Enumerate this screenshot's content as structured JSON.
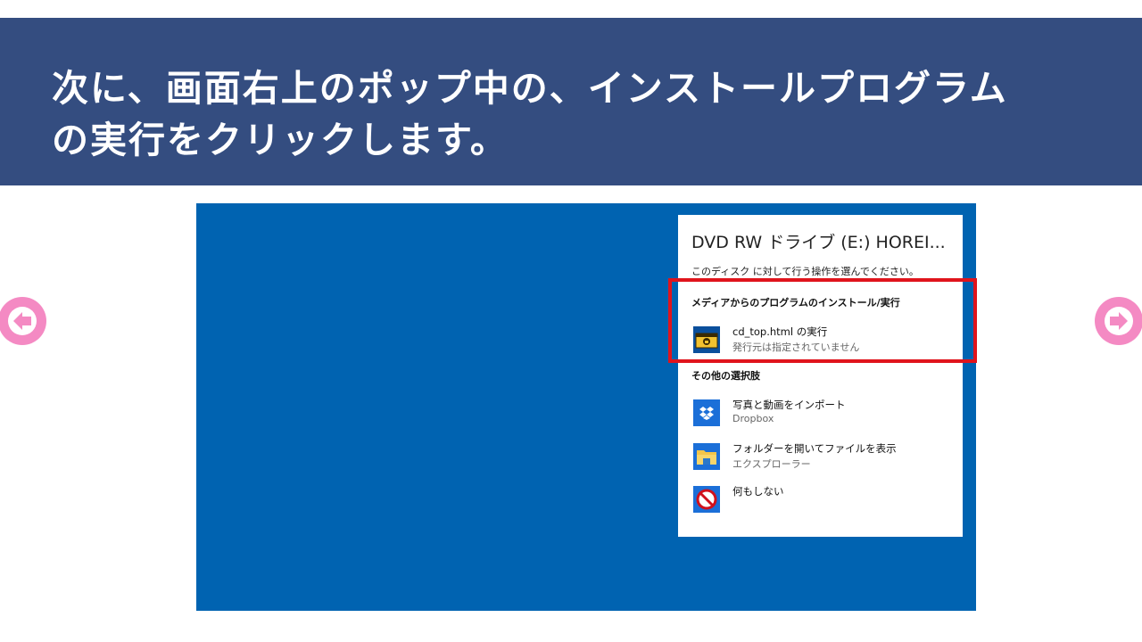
{
  "banner": {
    "text": "次に、画面右上のポップ中の、インストールプログラム\nの実行をクリックします。"
  },
  "colors": {
    "banner_bg": "#344d80",
    "screen_bg": "#0063b1",
    "highlight": "#e0141c",
    "nav_arrow": "#f48ac3"
  },
  "nav": {
    "prev_icon": "left-arrow-icon",
    "next_icon": "right-arrow-icon"
  },
  "popup": {
    "title": "DVD RW ドライブ (E:) HOREI...",
    "subtitle": "このディスク に対して行う操作を選んでください。",
    "section_install": "メディアからのプログラムのインストール/実行",
    "section_other": "その他の選択肢",
    "options": [
      {
        "main": "cd_top.html の実行",
        "sub": "発行元は指定されていません",
        "icon": "installer-icon"
      },
      {
        "main": "写真と動画をインポート",
        "sub": "Dropbox",
        "icon": "dropbox-icon"
      },
      {
        "main": "フォルダーを開いてファイルを表示",
        "sub": "エクスプローラー",
        "icon": "folder-icon"
      },
      {
        "main": "何もしない",
        "sub": "",
        "icon": "no-action-icon"
      }
    ]
  }
}
